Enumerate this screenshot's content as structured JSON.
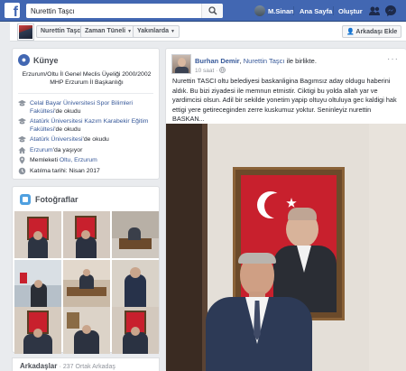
{
  "search": {
    "value": "Nurettin Taşcı"
  },
  "topnav": {
    "user": "M.Sinan",
    "home": "Ana Sayfa",
    "create": "Oluştur"
  },
  "profile_nav": {
    "name": "Nurettin Taşcı",
    "timeline": "Zaman Tüneli",
    "nearby": "Yakınlarda",
    "add_friend": "Arkadaşı Ekle"
  },
  "intro": {
    "title": "Künye",
    "bio": "Erzurum/Oltu İl Genel Meclis Üyeliği 2000/2002 MHP Erzurum İl Başkanlığı",
    "edu1_link": "Celal Bayar Üniversitesi Spor Bilimleri Fakültesi",
    "edu1_suffix": "'de okudu",
    "edu2_link": "Atatürk Üniversitesi Kazım Karabekir Eğitim Fakültesi",
    "edu2_suffix": "'de okudu",
    "edu3_link": "Atatürk Üniversitesi",
    "edu3_suffix": "'de okudu",
    "lives_link": "Erzurum",
    "lives_suffix": "'da yaşıyor",
    "from_prefix": "Memleketi ",
    "from_link": "Oltu, Erzurum",
    "joined": "Katılma tarihi: Nisan 2017"
  },
  "photos": {
    "title": "Fotoğraflar"
  },
  "friends": {
    "title": "Arkadaşlar",
    "mutual": "· 237 Ortak Arkadaş"
  },
  "post": {
    "author": "Burhan Demir",
    "with_text": ", ",
    "with_name": "Nurettin Taşcı",
    "with_suffix": " ile birlikte.",
    "time": "10 saat · ",
    "menu": "···",
    "text": "Nurettin TASCI oltu belediyesi baskanligina Bagımsız aday oldugu haberini aldık. Bu bizi ziyadesi ile memnun etmistir. Ciktigi bu yolda allah yar ve yardimcisi olsun. Adil bir sekilde yonetim yapip oltuyu oltuluya gec kaldigi hak ettigi yere getireceginden zerre kuskumuz yoktur. Seninleyiz nurettin BASKAN..."
  },
  "colors": {
    "brand": "#4267b2",
    "link": "#365899",
    "flag": "#c8202d"
  }
}
